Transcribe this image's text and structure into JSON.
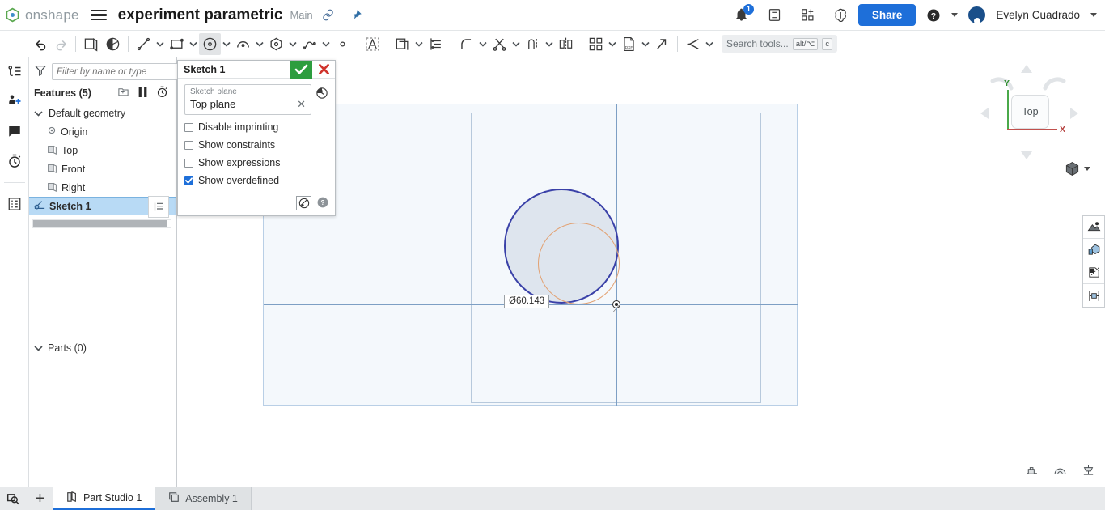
{
  "header": {
    "brand": "onshape",
    "menu_icon": "hamburger-icon",
    "doc_title": "experiment parametric",
    "branch": "Main",
    "link_icon": "link-icon",
    "pin_icon": "pin-icon",
    "notification_count": "1",
    "share_label": "Share",
    "user_name": "Evelyn Cuadrado"
  },
  "toolbar": {
    "items": [
      {
        "name": "undo-button",
        "icon": "undo-icon"
      },
      {
        "name": "redo-button",
        "icon": "redo-icon"
      },
      {
        "name": "sketch-button",
        "icon": "sketch-icon"
      },
      {
        "name": "plane-button",
        "icon": "plane-icon"
      },
      {
        "name": "line-tool",
        "icon": "line-icon"
      },
      {
        "name": "rectangle-tool",
        "icon": "rectangle-icon"
      },
      {
        "name": "circle-tool",
        "icon": "circle-icon"
      },
      {
        "name": "arc-tool",
        "icon": "arc-icon"
      },
      {
        "name": "polygon-tool",
        "icon": "polygon-icon"
      },
      {
        "name": "spline-tool",
        "icon": "spline-icon"
      },
      {
        "name": "point-tool",
        "icon": "point-icon"
      },
      {
        "name": "text-tool",
        "icon": "text-icon"
      },
      {
        "name": "offset-tool",
        "icon": "offset-icon"
      },
      {
        "name": "dimension-tool",
        "icon": "dimension-icon"
      },
      {
        "name": "fillet-tool",
        "icon": "fillet-icon"
      },
      {
        "name": "trim-tool",
        "icon": "trim-icon"
      },
      {
        "name": "extend-tool",
        "icon": "extend-icon"
      },
      {
        "name": "mirror-tool",
        "icon": "mirror-icon"
      },
      {
        "name": "pattern-tool",
        "icon": "pattern-icon"
      },
      {
        "name": "dxf-import-tool",
        "icon": "dxf-icon"
      },
      {
        "name": "transform-tool",
        "icon": "transform-icon"
      },
      {
        "name": "constraint-tool",
        "icon": "constraint-icon"
      }
    ],
    "search_placeholder": "Search tools...",
    "shortcut_alt": "alt/⌥",
    "shortcut_key": "c"
  },
  "rail": {
    "items": [
      {
        "name": "feature-list-icon",
        "label": "feature-list-icon"
      },
      {
        "name": "add-collaborator-icon",
        "label": "add-collaborator-icon"
      },
      {
        "name": "comments-icon",
        "label": "comments-icon"
      },
      {
        "name": "history-icon",
        "label": "history-icon"
      },
      {
        "name": "properties-icon",
        "label": "properties-icon"
      }
    ]
  },
  "feature_panel": {
    "filter_placeholder": "Filter by name or type",
    "features_label": "Features (5)",
    "head_icons": [
      "add-folder-icon",
      "pause-icon",
      "rollback-icon"
    ],
    "tree": [
      {
        "label": "Default geometry",
        "icon": "chevron-down-icon",
        "level": 0,
        "selected": false
      },
      {
        "label": "Origin",
        "icon": "origin-icon",
        "level": 1,
        "selected": false
      },
      {
        "label": "Top",
        "icon": "plane-icon",
        "level": 1,
        "selected": false
      },
      {
        "label": "Front",
        "icon": "plane-icon",
        "level": 1,
        "selected": false
      },
      {
        "label": "Right",
        "icon": "plane-icon",
        "level": 1,
        "selected": false
      },
      {
        "label": "Sketch 1",
        "icon": "sketch-icon",
        "level": 0,
        "selected": true
      }
    ],
    "parts_label": "Parts (0)"
  },
  "dialog": {
    "title": "Sketch 1",
    "confirm_icon": "checkmark-icon",
    "cancel_icon": "close-icon",
    "field_label": "Sketch plane",
    "field_value": "Top plane",
    "clear_icon": "clear-x-icon",
    "history_icon": "history-clock-icon",
    "checkboxes": [
      {
        "label": "Disable imprinting",
        "checked": false
      },
      {
        "label": "Show constraints",
        "checked": false
      },
      {
        "label": "Show expressions",
        "checked": false
      },
      {
        "label": "Show overdefined",
        "checked": true
      }
    ],
    "foot_icons": [
      "sketch-tools-icon",
      "help-icon"
    ]
  },
  "canvas": {
    "plane_label": "Top",
    "dimension_label": "Ø60.143",
    "viewcube_face": "Top",
    "axis_y_label": "Y",
    "axis_x_label": "X",
    "right_tools": [
      "render-icon",
      "display-style-icon",
      "section-view-icon",
      "explode-icon"
    ],
    "foot_icons": [
      "measure-icon",
      "mass-properties-icon",
      "comparison-icon"
    ]
  },
  "tabs": {
    "search_icon": "tab-search-icon",
    "add_label": "+",
    "items": [
      {
        "label": "Part Studio 1",
        "icon": "part-studio-icon",
        "active": true
      },
      {
        "label": "Assembly 1",
        "icon": "assembly-icon",
        "active": false
      }
    ]
  },
  "colors": {
    "accent": "#1e6fd9",
    "confirm": "#2d9d3f",
    "cancel": "#d0342c",
    "selection": "#b8daf5",
    "sketch_blue": "#3a41a8",
    "sketch_orange": "#e2a172"
  }
}
